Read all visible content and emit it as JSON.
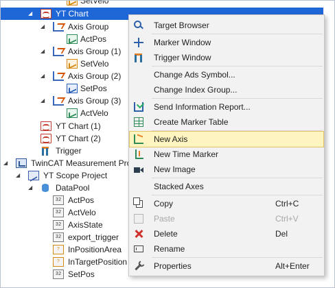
{
  "tree": {
    "items": [
      {
        "label": "SetVelo",
        "icon": "channel-icon"
      },
      {
        "label": "YT Chart",
        "icon": "yt-chart-icon",
        "selected": true,
        "expanded": true
      },
      {
        "label": "Axis Group",
        "icon": "axis-group-icon",
        "expanded": true
      },
      {
        "label": "ActPos",
        "icon": "channel-icon"
      },
      {
        "label": "Axis Group (1)",
        "icon": "axis-group-icon",
        "expanded": true
      },
      {
        "label": "SetVelo",
        "icon": "channel-icon"
      },
      {
        "label": "Axis Group (2)",
        "icon": "axis-group-icon",
        "expanded": true
      },
      {
        "label": "SetPos",
        "icon": "channel-icon"
      },
      {
        "label": "Axis Group (3)",
        "icon": "axis-group-icon",
        "expanded": true
      },
      {
        "label": "ActVelo",
        "icon": "channel-icon"
      },
      {
        "label": "YT Chart (1)",
        "icon": "yt-chart-icon"
      },
      {
        "label": "YT Chart (2)",
        "icon": "yt-chart-icon"
      },
      {
        "label": "Trigger",
        "icon": "trigger-icon"
      },
      {
        "label": "TwinCAT Measurement Pro",
        "icon": "measurement-project-icon",
        "expanded": true
      },
      {
        "label": "YT Scope Project",
        "icon": "scope-project-icon",
        "expanded": true
      },
      {
        "label": "DataPool",
        "icon": "datapool-icon",
        "expanded": true
      },
      {
        "label": "ActPos",
        "icon": "symbol-icon"
      },
      {
        "label": "ActVelo",
        "icon": "symbol-icon"
      },
      {
        "label": "AxisState",
        "icon": "symbol-icon"
      },
      {
        "label": "export_trigger",
        "icon": "symbol-icon"
      },
      {
        "label": "InPositionArea",
        "icon": "symbol-icon"
      },
      {
        "label": "InTargetPosition",
        "icon": "symbol-icon"
      },
      {
        "label": "SetPos",
        "icon": "symbol-icon"
      }
    ]
  },
  "context_menu": {
    "items": [
      {
        "label": "Target Browser",
        "icon": "target-browser-icon",
        "shortcut": ""
      },
      {
        "label": "Marker Window",
        "icon": "marker-window-icon",
        "shortcut": ""
      },
      {
        "label": "Trigger Window",
        "icon": "trigger-window-icon",
        "shortcut": ""
      },
      {
        "label": "Change Ads Symbol...",
        "icon": "",
        "shortcut": ""
      },
      {
        "label": "Change Index Group...",
        "icon": "",
        "shortcut": ""
      },
      {
        "label": "Send Information Report...",
        "icon": "send-report-icon",
        "shortcut": ""
      },
      {
        "label": "Create Marker Table",
        "icon": "marker-table-icon",
        "shortcut": ""
      },
      {
        "label": "New Axis",
        "icon": "new-axis-icon",
        "shortcut": "",
        "highlighted": true
      },
      {
        "label": "New Time Marker",
        "icon": "new-time-marker-icon",
        "shortcut": ""
      },
      {
        "label": "New Image",
        "icon": "new-image-icon",
        "shortcut": ""
      },
      {
        "label": "Stacked Axes",
        "icon": "",
        "shortcut": ""
      },
      {
        "label": "Copy",
        "icon": "copy-icon",
        "shortcut": "Ctrl+C"
      },
      {
        "label": "Paste",
        "icon": "paste-icon",
        "shortcut": "Ctrl+V",
        "disabled": true
      },
      {
        "label": "Delete",
        "icon": "delete-icon",
        "shortcut": "Del"
      },
      {
        "label": "Rename",
        "icon": "rename-icon",
        "shortcut": ""
      },
      {
        "label": "Properties",
        "icon": "properties-icon",
        "shortcut": "Alt+Enter"
      }
    ]
  },
  "colors": {
    "selection": "#1f66d6",
    "menu_background": "#f2f2f2",
    "menu_highlight": "#fdf4bf"
  }
}
